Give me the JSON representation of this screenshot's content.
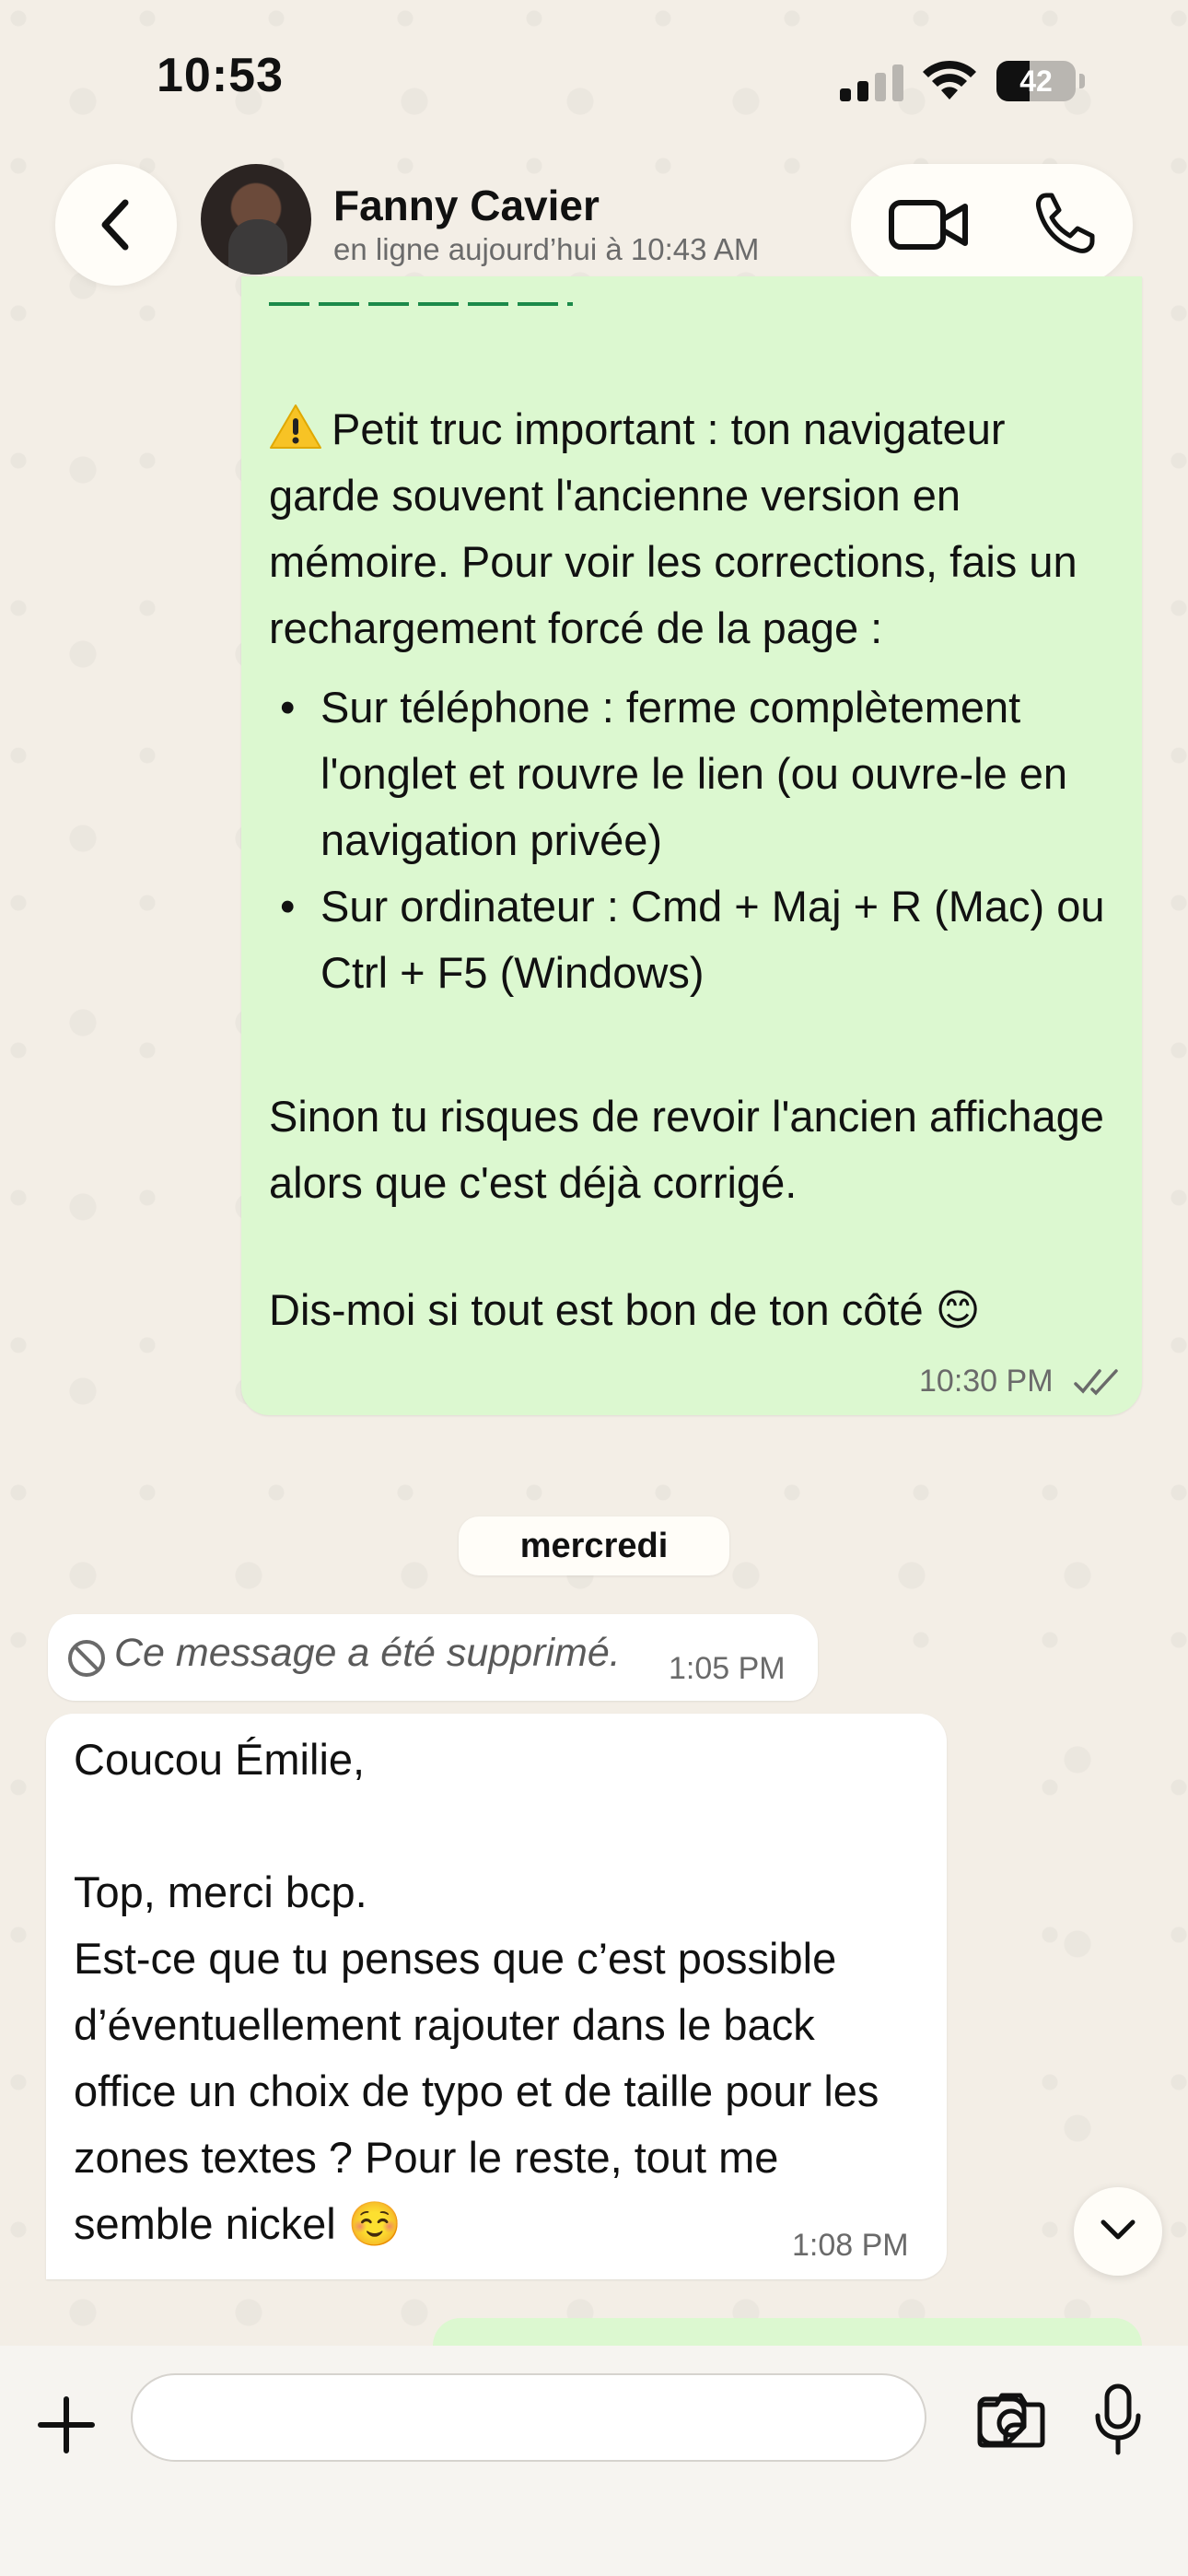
{
  "status_bar": {
    "time": "10:53",
    "battery_level": "42",
    "battery_fraction": 0.42
  },
  "header": {
    "contact_name": "Fanny Cavier",
    "contact_status": "en ligne aujourd’hui à 10:43 AM"
  },
  "messages": {
    "outgoing_1": {
      "warning_paragraph": "Petit truc important : ton navigateur garde souvent l'ancienne version en mémoire. Pour voir les corrections, fais un rechargement forcé de la page :",
      "bullets": [
        "Sur téléphone : ferme complètement l'onglet et rouvre le lien (ou ouvre-le en navigation privée)",
        "Sur ordinateur : Cmd + Maj + R (Mac) ou Ctrl + F5 (Windows)"
      ],
      "paragraph_2": "Sinon tu risques de revoir l'ancien affichage alors que c'est déjà corrigé.",
      "paragraph_3": "Dis-moi si tout est bon de ton côté 😊",
      "time": "10:30 PM",
      "status_icon": "double-check-icon"
    },
    "date_separator": "mercredi",
    "deleted": {
      "text": "Ce message a été supprimé.",
      "time": "1:05 PM"
    },
    "incoming_1": {
      "greeting": "Coucou Émilie,",
      "line_2": "Top, merci bcp.",
      "body": "Est-ce que tu penses que c’est possible d’éventuellement rajouter dans le back office un choix de typo et de taille pour les zones textes ? Pour le reste, tout me semble nickel ☺️",
      "time": "1:08 PM"
    }
  },
  "input_bar": {
    "placeholder": ""
  },
  "colors": {
    "outgoing_bubble": "#dcf8d0",
    "incoming_bubble": "#ffffff",
    "background": "#f3eee6",
    "link_green": "#1c8a4a"
  }
}
